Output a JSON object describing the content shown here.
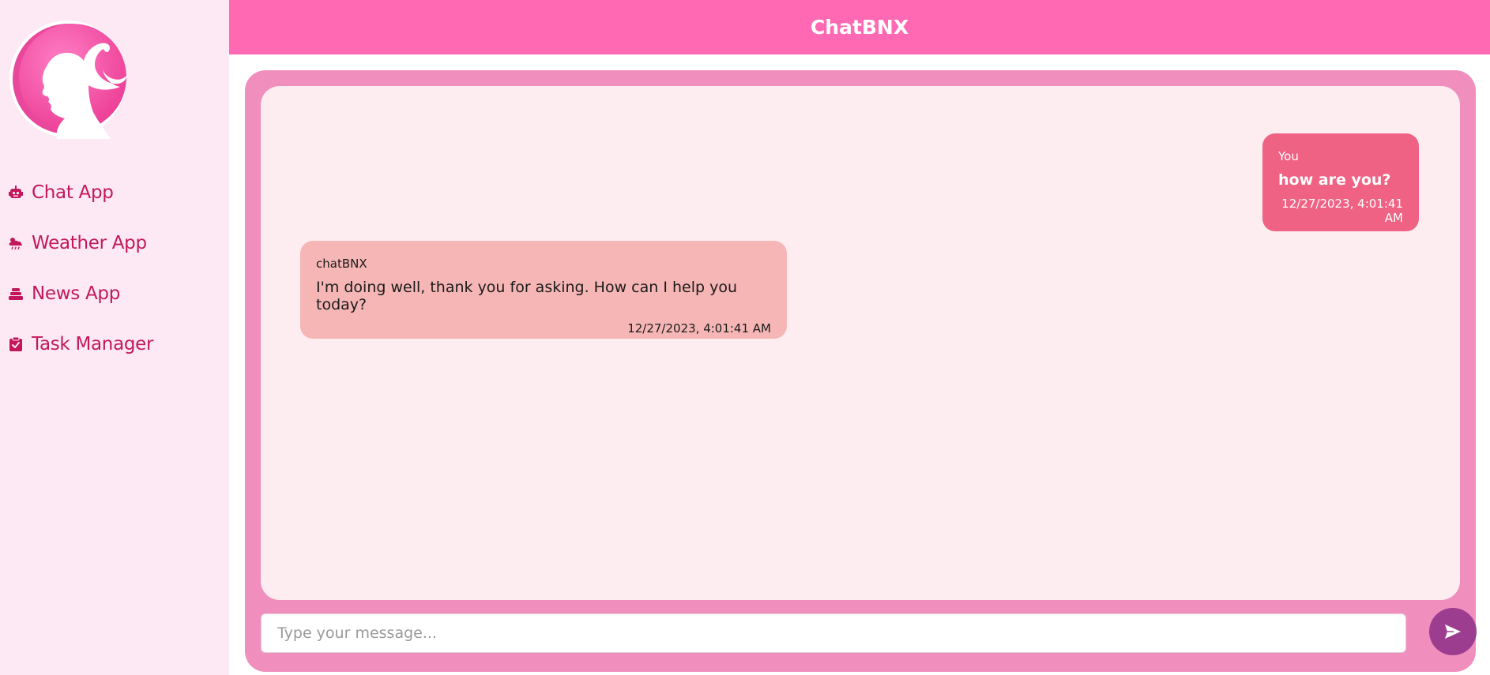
{
  "app": {
    "title": "ChatBNX"
  },
  "theme": {
    "sidebar_bg": "#fde9f3",
    "header_bg": "#ff69b4",
    "nav_text": "#c2185b",
    "frame_bg": "#f08fbd",
    "user_bubble": "#ef6283",
    "bot_bubble": "#f6b6b6",
    "send_button": "#9c3d8f"
  },
  "sidebar": {
    "logo_icon": "woman-silhouette-ponytail-logo",
    "items": [
      {
        "label": "Chat App",
        "icon": "robot-icon"
      },
      {
        "label": "Weather App",
        "icon": "cloud-sun-rain-icon"
      },
      {
        "label": "News App",
        "icon": "stacked-layers-icon"
      },
      {
        "label": "Task Manager",
        "icon": "clipboard-check-icon"
      }
    ]
  },
  "messages": [
    {
      "sender": "You",
      "text": "how are you?",
      "timestamp": "12/27/2023, 4:01:41 AM"
    },
    {
      "sender": "chatBNX",
      "text": "I'm doing well, thank you for asking. How can I help you today?",
      "timestamp": "12/27/2023, 4:01:41 AM"
    }
  ],
  "composer": {
    "placeholder": "Type your message...",
    "value": "",
    "send_icon": "paper-plane-icon"
  }
}
